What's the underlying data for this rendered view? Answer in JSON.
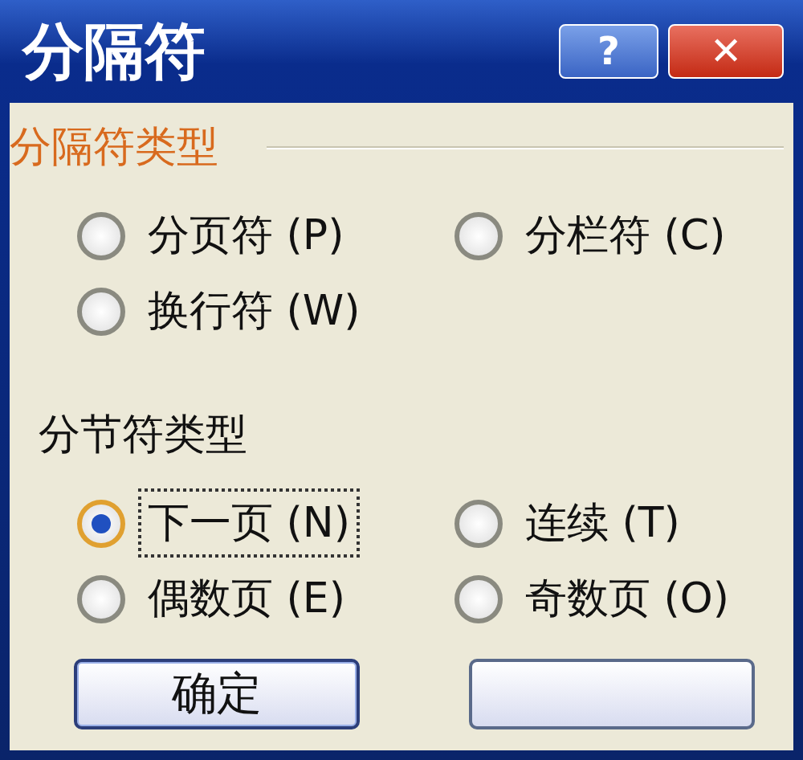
{
  "window": {
    "title": "分隔符"
  },
  "title_buttons": [
    {
      "kind": "help",
      "label": "?"
    },
    {
      "kind": "close",
      "label": "✕"
    }
  ],
  "break_types": {
    "title": "分隔符类型",
    "options": [
      {
        "label": "分页符 (P)",
        "selected": false,
        "focused": false
      },
      {
        "label": "分栏符 (C)",
        "selected": false,
        "focused": false
      },
      {
        "label": "换行符 (W)",
        "selected": false,
        "focused": false
      }
    ]
  },
  "section_break_types": {
    "title": "分节符类型",
    "options": [
      {
        "label": "下一页 (N)",
        "selected": true,
        "focused": true
      },
      {
        "label": "连续 (T)",
        "selected": false,
        "focused": false
      },
      {
        "label": "偶数页 (E)",
        "selected": false,
        "focused": false
      },
      {
        "label": "奇数页 (O)",
        "selected": false,
        "focused": false
      }
    ]
  },
  "buttons": [
    {
      "kind": "ok",
      "label": "确定"
    },
    {
      "kind": "cancel"
    }
  ]
}
